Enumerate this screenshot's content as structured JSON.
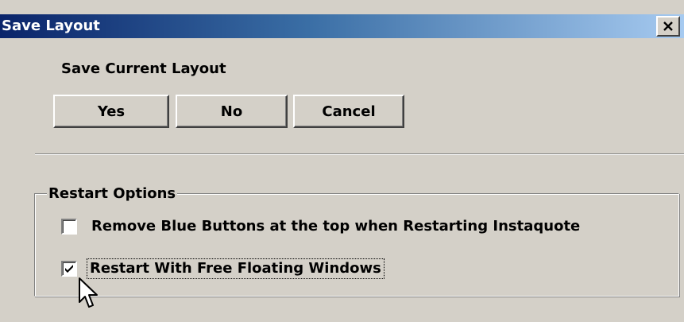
{
  "window": {
    "title": "Save Layout",
    "close_label": "X"
  },
  "save_section": {
    "heading": "Save Current Layout",
    "buttons": {
      "yes": "Yes",
      "no": "No",
      "cancel": "Cancel"
    }
  },
  "restart_options": {
    "legend": "Restart Options",
    "options": [
      {
        "label": "Remove Blue Buttons at the top when Restarting Instaquote",
        "checked": false
      },
      {
        "label": "Restart With Free Floating Windows",
        "checked": true
      }
    ]
  },
  "icons": {
    "close": "close-icon",
    "checkmark": "checkmark-icon",
    "cursor": "mouse-pointer-icon"
  },
  "colors": {
    "dialog_face": "#d4d0c8",
    "titlebar_start": "#0a246a",
    "titlebar_end": "#a6caf0"
  }
}
